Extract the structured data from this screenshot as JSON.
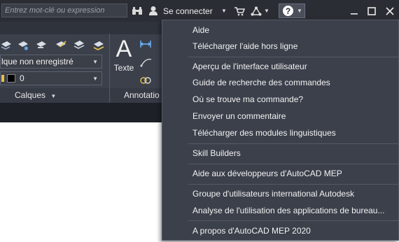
{
  "search": {
    "placeholder": "Entrez mot-clé ou expression"
  },
  "toolbar": {
    "sign_in_label": "Se connecter",
    "icons": [
      "binoculars-icon",
      "user-icon",
      "cart-icon",
      "network-icon",
      "help-icon"
    ]
  },
  "ribbon": {
    "layer_dropdown": "lque non enregistré",
    "layer_number": "0",
    "calques_label": "Calques",
    "texte_label": "Texte",
    "annotation_label": "Annotatio"
  },
  "help_menu": {
    "items": [
      "Aide",
      "Télécharger l'aide hors ligne",
      "Aperçu de l'interface utilisateur",
      "Guide de recherche des commandes",
      "Où se trouve ma commande?",
      "Envoyer un commentaire",
      "Télécharger des modules linguistiques",
      "Skill Builders",
      "Aide aux développeurs d'AutoCAD MEP",
      "Groupe d'utilisateurs international Autodesk",
      "Analyse de l'utilisation des applications de bureau...",
      "A propos d'AutoCAD MEP 2020"
    ]
  },
  "colors": {
    "titlebar": "#2b2d34",
    "ribbon": "#3b404b",
    "menu": "#3b404b",
    "canvas": "#ffffff"
  }
}
